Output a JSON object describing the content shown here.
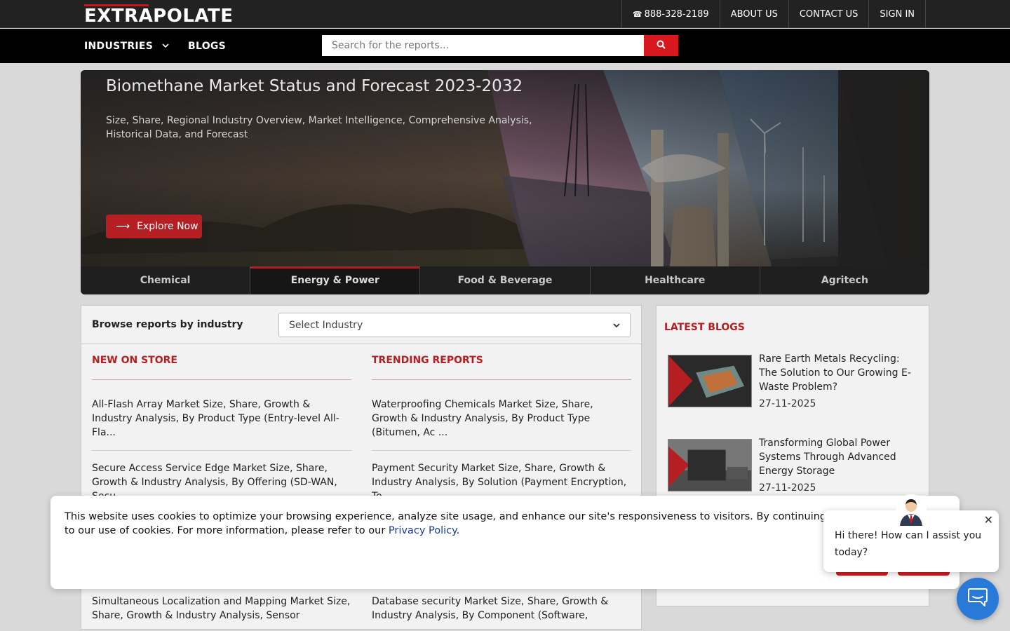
{
  "brand": {
    "logo_text": "EXTRAPOLATE",
    "accent": "#c8161d"
  },
  "topbar": {
    "phone": "888-328-2189",
    "links": [
      "ABOUT US",
      "CONTACT US",
      "SIGN IN"
    ]
  },
  "nav": {
    "industries": "INDUSTRIES",
    "blogs": "BLOGS",
    "search_placeholder": "Search for the reports..."
  },
  "hero": {
    "title": "Biomethane Market Status and Forecast 2023-2032",
    "subtitle": "Size, Share, Regional Industry Overview, Market Intelligence, Comprehensive Analysis, Historical Data, and Forecast",
    "cta": "Explore Now",
    "tabs": [
      "Chemical",
      "Energy & Power",
      "Food & Beverage",
      "Healthcare",
      "Agritech"
    ],
    "active_tab": "Energy & Power"
  },
  "browse": {
    "label": "Browse reports by industry",
    "select_value": "Select Industry"
  },
  "new_on_store": {
    "heading": "NEW ON STORE",
    "items": [
      "All-Flash Array Market Size, Share, Growth & Industry Analysis, By Product Type (Entry-level All-Fla...",
      "Secure Access Service Edge Market Size, Share, Growth & Industry Analysis, By Offering (SD-WAN, Secu...",
      "Simultaneous Localization and Mapping Market Size, Share, Growth & Industry Analysis, Sensor"
    ]
  },
  "trending": {
    "heading": "TRENDING REPORTS",
    "items": [
      "Waterproofing Chemicals Market Size, Share, Growth & Industry Analysis, By Product Type (Bitumen, Ac ...",
      "Payment Security Market Size, Share, Growth & Industry Analysis, By Solution (Payment Encryption, To...",
      "Database security Market Size, Share, Growth & Industry Analysis, By Component (Software,"
    ]
  },
  "blogs": {
    "heading": "LATEST BLOGS",
    "items": [
      {
        "title": "Rare Earth Metals Recycling: The Solution to Our Growing E-Waste Problem?",
        "date": "27-11-2025"
      },
      {
        "title": "Transforming Global Power Systems Through Advanced Energy Storage",
        "date": "27-11-2025"
      }
    ]
  },
  "cookie": {
    "text": "This website uses cookies to optimize your browsing experience, analyze site usage, and enhance our site's responsiveness to visitors. By continuing to browse, you agree to our use of cookies. For more information, please refer to our ",
    "link": "Privacy Policy",
    "end": "."
  },
  "chat": {
    "greeting": "Hi there! How can I assist you today?",
    "launcher_color": "#2979d9"
  }
}
